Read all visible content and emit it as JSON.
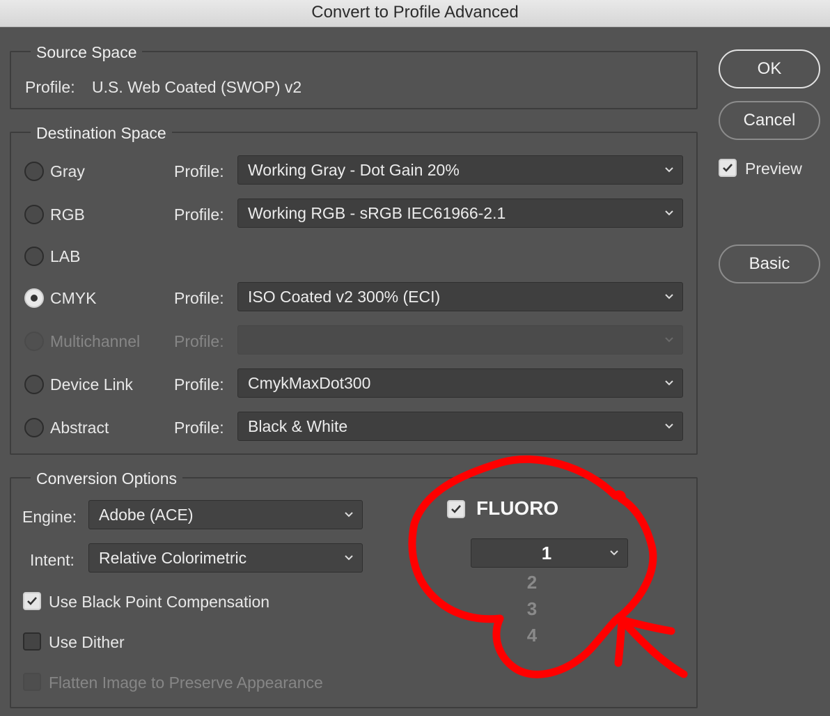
{
  "window": {
    "title": "Convert to Profile Advanced"
  },
  "source_space": {
    "legend": "Source Space",
    "profile_label": "Profile:",
    "profile_value": "U.S. Web Coated (SWOP) v2"
  },
  "destination_space": {
    "legend": "Destination Space",
    "profile_label": "Profile:",
    "rows": [
      {
        "label": "Gray",
        "profile": "Working Gray - Dot Gain 20%"
      },
      {
        "label": "RGB",
        "profile": "Working RGB - sRGB IEC61966-2.1"
      },
      {
        "label": "LAB"
      },
      {
        "label": "CMYK",
        "profile": "ISO Coated v2 300% (ECI)",
        "selected": true
      },
      {
        "label": "Multichannel",
        "profile": "",
        "disabled": true
      },
      {
        "label": "Device Link",
        "profile": "CmykMaxDot300"
      },
      {
        "label": "Abstract",
        "profile": "Black & White"
      }
    ]
  },
  "conversion_options": {
    "legend": "Conversion Options",
    "engine_label": "Engine:",
    "engine_value": "Adobe (ACE)",
    "intent_label": "Intent:",
    "intent_value": "Relative Colorimetric",
    "black_point": {
      "label": "Use Black Point Compensation",
      "checked": true
    },
    "dither": {
      "label": "Use Dither",
      "checked": false
    },
    "flatten": {
      "label": "Flatten Image to Preserve Appearance",
      "checked": false,
      "disabled": true
    }
  },
  "fluoro": {
    "label": "FLUORO",
    "checked": true,
    "selected_value": "1",
    "options": [
      "2",
      "3",
      "4"
    ],
    "annotation_color": "#ff0000"
  },
  "buttons": {
    "ok": "OK",
    "cancel": "Cancel",
    "preview_label": "Preview",
    "preview_checked": true,
    "basic": "Basic"
  }
}
